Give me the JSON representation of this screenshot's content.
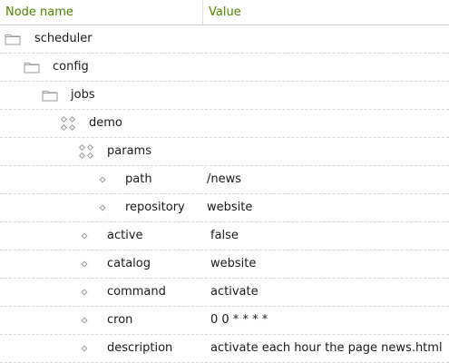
{
  "header": {
    "node_name_label": "Node name",
    "value_label": "Value"
  },
  "nodes": [
    {
      "name": "scheduler",
      "value": "",
      "type": "folder",
      "icon": "folder-icon"
    },
    {
      "name": "config",
      "value": "",
      "type": "folder",
      "icon": "folder-icon"
    },
    {
      "name": "jobs",
      "value": "",
      "type": "folder",
      "icon": "folder-icon"
    },
    {
      "name": "demo",
      "value": "",
      "type": "content",
      "icon": "content-node-icon"
    },
    {
      "name": "params",
      "value": "",
      "type": "content",
      "icon": "content-node-icon"
    },
    {
      "name": "path",
      "value": "/news",
      "type": "property",
      "icon": "property-icon"
    },
    {
      "name": "repository",
      "value": "website",
      "type": "property",
      "icon": "property-icon"
    },
    {
      "name": "active",
      "value": "false",
      "type": "property",
      "icon": "property-icon"
    },
    {
      "name": "catalog",
      "value": "website",
      "type": "property",
      "icon": "property-icon"
    },
    {
      "name": "command",
      "value": "activate",
      "type": "property",
      "icon": "property-icon"
    },
    {
      "name": "cron",
      "value": "0 0 * * * *",
      "type": "property",
      "icon": "property-icon"
    },
    {
      "name": "description",
      "value": "activate each hour the page news.html",
      "type": "property",
      "icon": "property-icon"
    }
  ],
  "colors": {
    "header_text": "#4f8400",
    "icon_stroke": "#9a9a9a"
  }
}
